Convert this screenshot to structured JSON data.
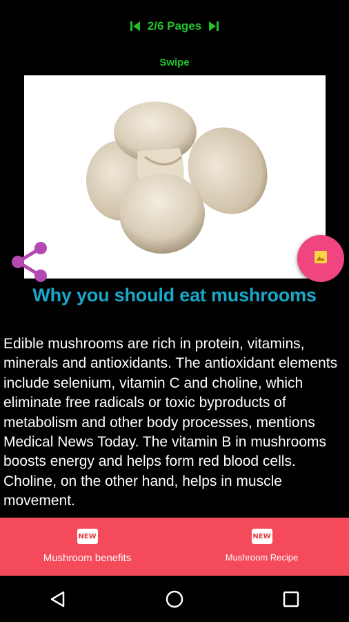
{
  "pager": {
    "text": "2/6 Pages",
    "prev_icon": "skip-previous-icon",
    "next_icon": "skip-next-icon",
    "color": "#22c32e"
  },
  "swipe_label": "Swipe",
  "image": {
    "description_icon": "mushrooms-photo"
  },
  "share_icon": "share-icon",
  "fab": {
    "icon": "image-icon",
    "color": "#f0457e"
  },
  "title": "Why you should eat mushrooms",
  "body": "Edible mushrooms are rich in protein, vitamins, minerals and antioxidants. The antioxidant elements include selenium, vitamin C and choline, which eliminate free radicals or toxic byproducts of metabolism and other body processes, mentions Medical News Today. The vitamin B in mushrooms boosts energy and helps form red blood cells. Choline, on the other hand, helps in muscle movement.",
  "bottom_tabs": [
    {
      "label": "Mushroom benefits",
      "badge": "NEW"
    },
    {
      "label": "Mushroom Recipe",
      "badge": "NEW"
    }
  ],
  "nav": {
    "back_icon": "back-icon",
    "home_icon": "home-icon",
    "recents_icon": "recents-icon"
  },
  "colors": {
    "title": "#19a8c9",
    "bottom_bar": "#f44a5a",
    "share": "#b548b3"
  }
}
